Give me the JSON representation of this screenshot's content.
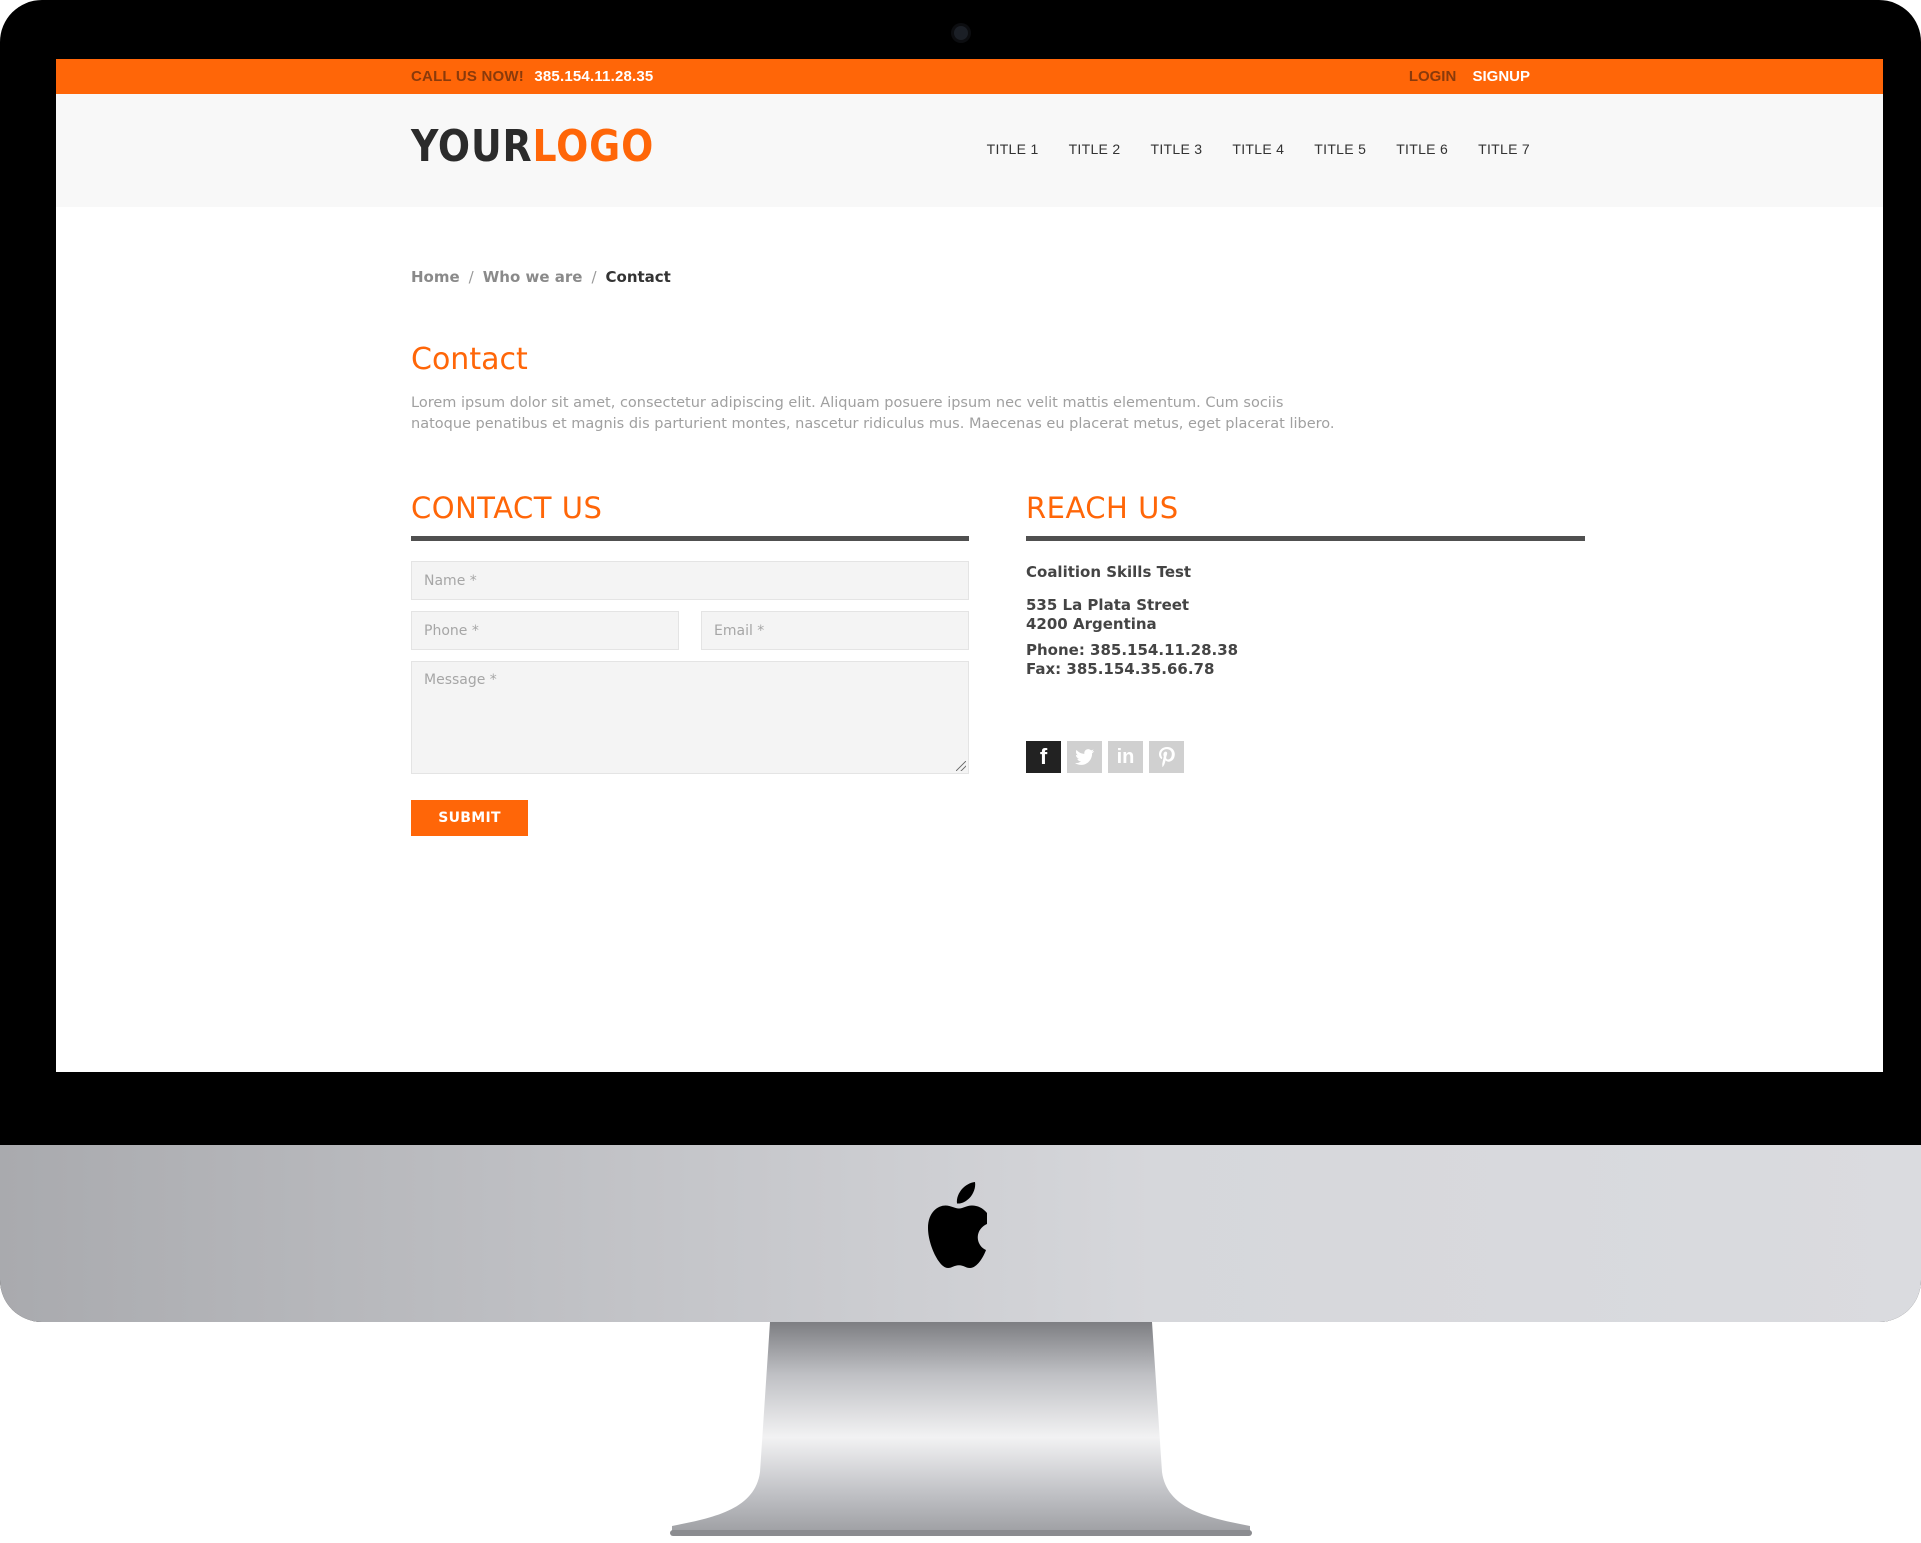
{
  "topbar": {
    "call_label": "CALL US NOW!",
    "phone": "385.154.11.28.35",
    "login": "LOGIN",
    "signup": "SIGNUP"
  },
  "header": {
    "logo_part1": "YOUR",
    "logo_part2": "LOGO",
    "nav": [
      "TITLE 1",
      "TITLE 2",
      "TITLE 3",
      "TITLE 4",
      "TITLE 5",
      "TITLE 6",
      "TITLE 7"
    ]
  },
  "breadcrumb": {
    "items": [
      "Home",
      "Who we are"
    ],
    "separator": "/",
    "current": "Contact"
  },
  "page": {
    "title": "Contact",
    "intro": "Lorem ipsum dolor sit amet, consectetur adipiscing elit. Aliquam posuere ipsum nec velit mattis elementum. Cum sociis natoque penatibus et magnis dis parturient montes, nascetur ridiculus mus. Maecenas eu placerat metus, eget placerat libero."
  },
  "contact_form": {
    "heading": "CONTACT US",
    "name_placeholder": "Name *",
    "phone_placeholder": "Phone *",
    "email_placeholder": "Email *",
    "message_placeholder": "Message *",
    "submit_label": "SUBMIT"
  },
  "reach_us": {
    "heading": "REACH US",
    "company": "Coalition Skills Test",
    "address_line1": "535 La Plata Street",
    "address_line2": "4200 Argentina",
    "phone": "Phone: 385.154.11.28.38",
    "fax": "Fax: 385.154.35.66.78",
    "social": [
      "facebook-icon",
      "twitter-icon",
      "linkedin-icon",
      "pinterest-icon"
    ]
  },
  "colors": {
    "accent": "#ff6608",
    "dark": "#333333",
    "muted": "#a0a0a0"
  }
}
